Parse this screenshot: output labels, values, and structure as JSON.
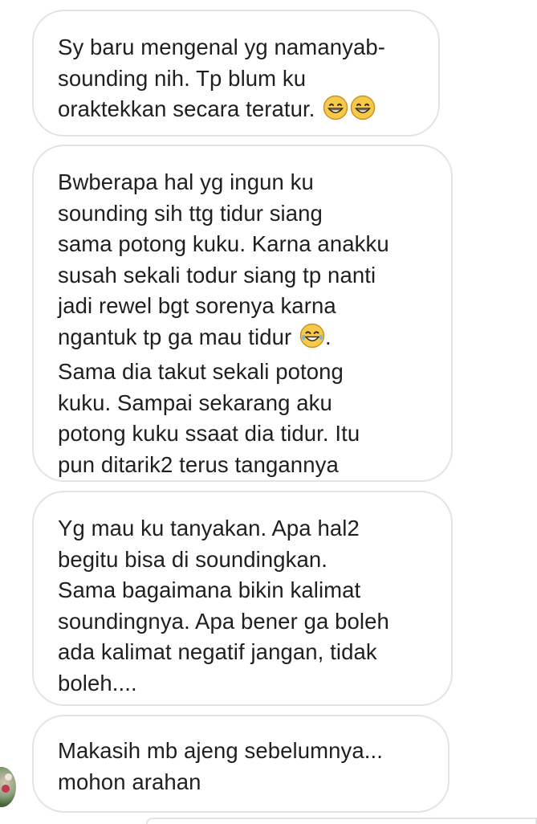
{
  "messages": [
    {
      "segments": [
        {
          "text": "Sy baru mengenal yg namanyab-\nsounding nih. Tp blum ku\noraktekkan secara teratur. "
        }
      ],
      "emoji": [
        "grinning-face-with-smiling-eyes",
        "grinning-face-with-smiling-eyes"
      ]
    },
    {
      "line1": "Bwberapa hal yg ingun ku\nsounding sih ttg tidur siang\nsama potong kuku. Karna anakku\nsusah sekali todur siang tp nanti\njadi rewel bgt sorenya karna\nngantuk tp ga mau tidur ",
      "emoji": [
        "face-with-tears-of-joy"
      ],
      "line2": ".\nSama dia takut sekali potong\nkuku. Sampai sekarang aku\npotong kuku ssaat dia tidur. Itu\npun ditarik2 terus tangannya"
    },
    {
      "text": "Yg mau ku tanyakan. Apa hal2\nbegitu bisa di soundingkan.\nSama bagaimana bikin kalimat\nsoundingnya. Apa bener ga boleh\nada kalimat negatif jangan, tidak\nboleh...."
    },
    {
      "text": "Makasih mb ajeng sebelumnya...\nmohon arahan"
    }
  ],
  "colors": {
    "bubble_border": "#e3e3e3",
    "text": "#1f1f1f",
    "emoji_face": "#f7c948",
    "emoji_outline": "#c9932b"
  }
}
